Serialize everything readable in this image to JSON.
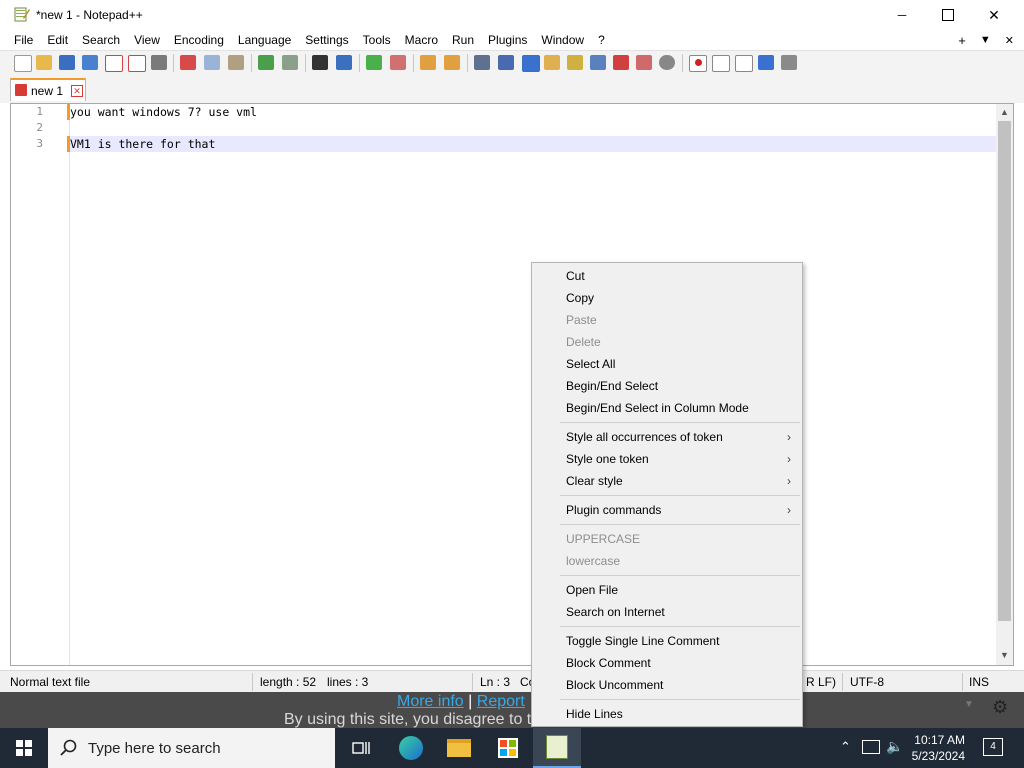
{
  "window": {
    "title": "*new 1 - Notepad++",
    "min_glyph": "—",
    "max_glyph": "☐",
    "close_glyph": "✕"
  },
  "menubar": {
    "items": [
      "File",
      "Edit",
      "Search",
      "View",
      "Encoding",
      "Language",
      "Settings",
      "Tools",
      "Macro",
      "Run",
      "Plugins",
      "Window",
      "?"
    ],
    "right_plus": "+",
    "right_down": "▼",
    "right_close": "✕"
  },
  "tab": {
    "label": "new 1",
    "close_glyph": "✕"
  },
  "editor": {
    "line_numbers": [
      "1",
      "2",
      "3"
    ],
    "lines": [
      "you want windows 7? use vml",
      "",
      "VM1 is there for that"
    ]
  },
  "statusbar": {
    "file_type": "Normal text file",
    "length": "length : 52",
    "lines": "lines : 3",
    "ln": "Ln : 3",
    "col_partial": "Co",
    "eol_partial": "R LF)",
    "encoding": "UTF-8",
    "mode": "INS"
  },
  "background_web": {
    "link1": "More info",
    "sep": "|",
    "link2": "Report",
    "text": "By using this site, you disagree to t"
  },
  "context_menu": {
    "items": [
      {
        "label": "Cut",
        "disabled": false
      },
      {
        "label": "Copy",
        "disabled": false
      },
      {
        "label": "Paste",
        "disabled": true
      },
      {
        "label": "Delete",
        "disabled": true
      },
      {
        "label": "Select All",
        "disabled": false
      },
      {
        "label": "Begin/End Select",
        "disabled": false
      },
      {
        "label": "Begin/End Select in Column Mode",
        "disabled": false
      },
      {
        "label": "Style all occurrences of token",
        "disabled": false,
        "submenu": true
      },
      {
        "label": "Style one token",
        "disabled": false,
        "submenu": true
      },
      {
        "label": "Clear style",
        "disabled": false,
        "submenu": true
      },
      {
        "label": "Plugin commands",
        "disabled": false,
        "submenu": true
      },
      {
        "label": "UPPERCASE",
        "disabled": true
      },
      {
        "label": "lowercase",
        "disabled": true
      },
      {
        "label": "Open File",
        "disabled": false
      },
      {
        "label": "Search on Internet",
        "disabled": false
      },
      {
        "label": "Toggle Single Line Comment",
        "disabled": false
      },
      {
        "label": "Block Comment",
        "disabled": false
      },
      {
        "label": "Block Uncomment",
        "disabled": false
      },
      {
        "label": "Hide Lines",
        "disabled": false
      }
    ],
    "submenu_arrow": "›"
  },
  "taskbar": {
    "search_placeholder": "Type here to search",
    "time": "10:17 AM",
    "date": "5/23/2024",
    "notification_count": "4"
  },
  "colors": {
    "accent_orange": "#f39b2a",
    "current_line": "#e8e8ff",
    "taskbar_bg": "#202a36",
    "link_blue": "#38a8e6"
  }
}
